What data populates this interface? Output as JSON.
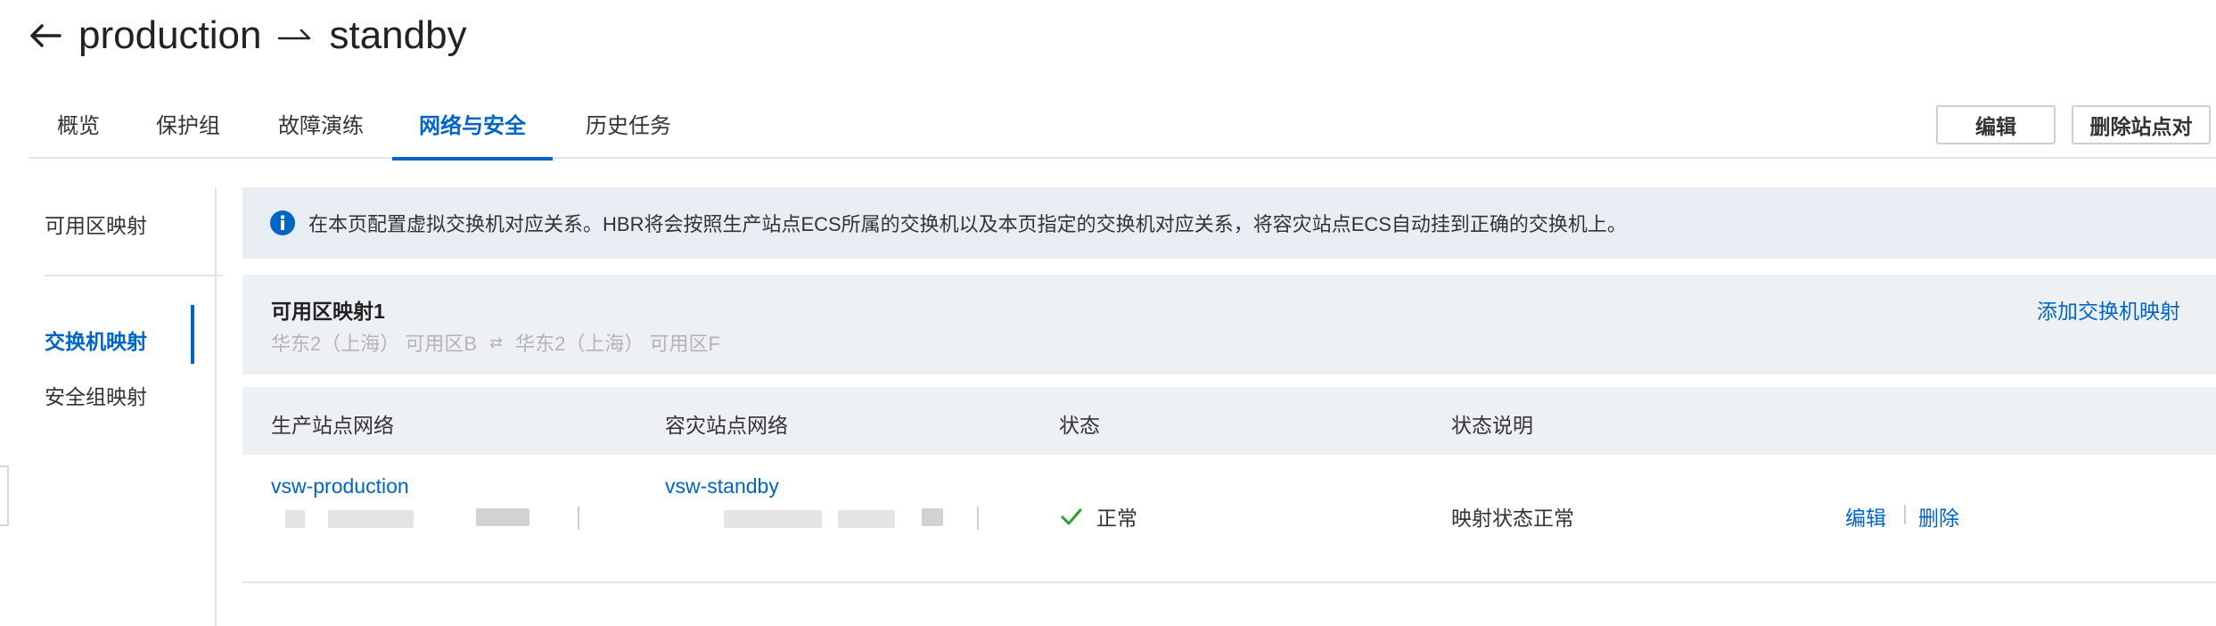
{
  "header": {
    "title_from": "production",
    "title_to": "standby"
  },
  "tabs": [
    {
      "label": "概览"
    },
    {
      "label": "保护组"
    },
    {
      "label": "故障演练"
    },
    {
      "label": "网络与安全",
      "active": true
    },
    {
      "label": "历史任务"
    }
  ],
  "actions": {
    "edit_label": "编辑",
    "delete_pair_label": "删除站点对"
  },
  "side_nav": {
    "items": [
      {
        "label": "可用区映射"
      },
      {
        "label": "交换机映射",
        "active": true
      },
      {
        "label": "安全组映射"
      }
    ]
  },
  "info_banner": {
    "text": "在本页配置虚拟交换机对应关系。HBR将会按照生产站点ECS所属的交换机以及本页指定的交换机对应关系，将容灾站点ECS自动挂到正确的交换机上。"
  },
  "zone_mapping": {
    "title": "可用区映射1",
    "source_zone": "华东2（上海） 可用区B",
    "target_zone": "华东2（上海） 可用区F",
    "add_link": "添加交换机映射"
  },
  "table": {
    "columns": [
      "生产站点网络",
      "容灾站点网络",
      "状态",
      "状态说明"
    ],
    "rows": [
      {
        "production_network": "vsw-production",
        "standby_network": "vsw-standby",
        "status": "正常",
        "status_desc": "映射状态正常",
        "actions": [
          "编辑",
          "删除"
        ]
      }
    ]
  },
  "colors": {
    "accent": "#0064c8",
    "status_ok": "#2ca02c"
  }
}
